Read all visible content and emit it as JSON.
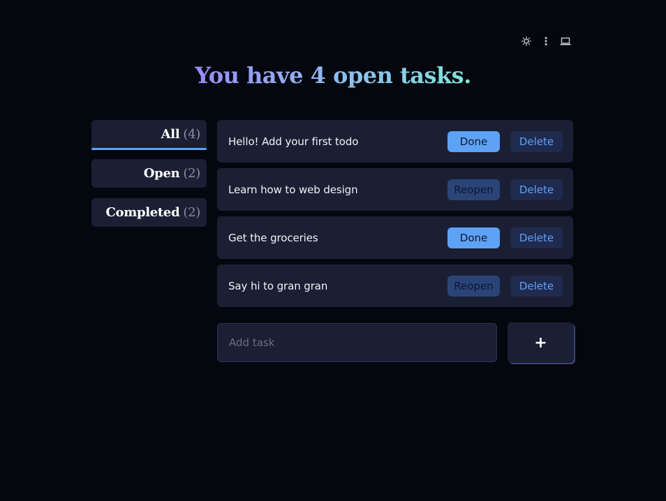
{
  "theme_switch": {
    "icons": [
      "sun-icon",
      "more-vertical-icon",
      "laptop-icon"
    ]
  },
  "headline": "You have 4 open tasks.",
  "filters": [
    {
      "label": "All",
      "count": "(4)",
      "active": true
    },
    {
      "label": "Open",
      "count": "(2)",
      "active": false
    },
    {
      "label": "Completed",
      "count": "(2)",
      "active": false
    }
  ],
  "todos": [
    {
      "text": "Hello! Add your first todo",
      "action": "Done",
      "delete": "Delete"
    },
    {
      "text": "Learn how to web design",
      "action": "Reopen",
      "delete": "Delete"
    },
    {
      "text": "Get the groceries",
      "action": "Done",
      "delete": "Delete"
    },
    {
      "text": "Say hi to gran gran",
      "action": "Reopen",
      "delete": "Delete"
    }
  ],
  "add": {
    "placeholder": "Add task",
    "value": "",
    "button_label": "+"
  },
  "colors": {
    "background": "#05070f",
    "card": "#1b1f33",
    "accent": "#5ea2f5",
    "reopen": "#2a4477",
    "delete_bg": "#202a4e"
  }
}
